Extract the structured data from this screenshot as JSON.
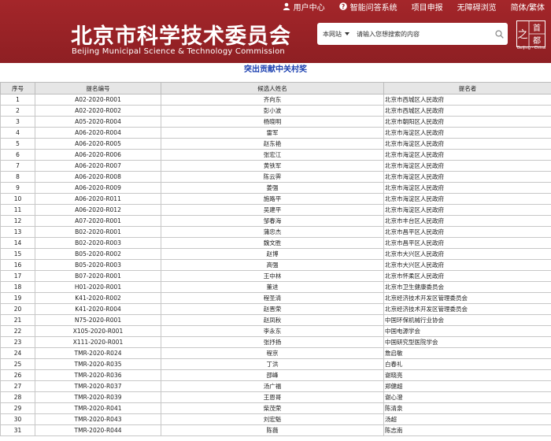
{
  "topnav": [
    {
      "icon": "user-icon",
      "label": "用户中心"
    },
    {
      "icon": "help-icon",
      "label": "智能问答系统"
    },
    {
      "icon": "",
      "label": "项目申报"
    },
    {
      "icon": "",
      "label": "无障碍浏览"
    },
    {
      "icon": "",
      "label": "简体/繁体"
    }
  ],
  "site": {
    "title": "北京市科学技术委员会",
    "subtitle": "Beijing Municipal Science & Technology Commission",
    "emblem_text": "之首都",
    "emblem_sub": "Beijing · China"
  },
  "search": {
    "scope": "本网站",
    "placeholder": "请输入您想搜索的内容"
  },
  "page_title": "突出贡献中关村奖",
  "table": {
    "headers": [
      "序号",
      "提名编号",
      "候选人姓名",
      "提名者"
    ],
    "rows": [
      [
        "1",
        "A02-2020-R001",
        "齐向东",
        "北京市西城区人民政府"
      ],
      [
        "2",
        "A02-2020-R002",
        "彭小波",
        "北京市西城区人民政府"
      ],
      [
        "3",
        "A05-2020-R004",
        "杨晓明",
        "北京市朝阳区人民政府"
      ],
      [
        "4",
        "A06-2020-R004",
        "雷军",
        "北京市海淀区人民政府"
      ],
      [
        "5",
        "A06-2020-R005",
        "赵东艳",
        "北京市海淀区人民政府"
      ],
      [
        "6",
        "A06-2020-R006",
        "张宏江",
        "北京市海淀区人民政府"
      ],
      [
        "7",
        "A06-2020-R007",
        "黄铁军",
        "北京市海淀区人民政府"
      ],
      [
        "8",
        "A06-2020-R008",
        "陈云霁",
        "北京市海淀区人民政府"
      ],
      [
        "9",
        "A06-2020-R009",
        "姜强",
        "北京市海淀区人民政府"
      ],
      [
        "10",
        "A06-2020-R011",
        "施路平",
        "北京市海淀区人民政府"
      ],
      [
        "11",
        "A06-2020-R012",
        "吴建平",
        "北京市海淀区人民政府"
      ],
      [
        "12",
        "A07-2020-R001",
        "邹春海",
        "北京市丰台区人民政府"
      ],
      [
        "13",
        "B02-2020-R001",
        "蒲忠杰",
        "北京市昌平区人民政府"
      ],
      [
        "14",
        "B02-2020-R003",
        "魏文胜",
        "北京市昌平区人民政府"
      ],
      [
        "15",
        "B05-2020-R002",
        "赵博",
        "北京市大兴区人民政府"
      ],
      [
        "16",
        "B05-2020-R003",
        "高强",
        "北京市大兴区人民政府"
      ],
      [
        "17",
        "B07-2020-R001",
        "王中林",
        "北京市怀柔区人民政府"
      ],
      [
        "18",
        "H01-2020-R001",
        "董进",
        "北京市卫生健康委员会"
      ],
      [
        "19",
        "K41-2020-R002",
        "程圣清",
        "北京经济技术开发区管理委员会"
      ],
      [
        "20",
        "K41-2020-R004",
        "赵晋荣",
        "北京经济技术开发区管理委员会"
      ],
      [
        "21",
        "N75-2020-R001",
        "赵凤秋",
        "中国环保机械行业协会"
      ],
      [
        "22",
        "X105-2020-R001",
        "李永东",
        "中国电源学会"
      ],
      [
        "23",
        "X111-2020-R001",
        "张抒扬",
        "中国研究型医院学会"
      ],
      [
        "24",
        "TMR-2020-R024",
        "程京",
        "詹启敏"
      ],
      [
        "25",
        "TMR-2020-R035",
        "丁洪",
        "白春礼"
      ],
      [
        "26",
        "TMR-2020-R036",
        "邵峰",
        "谢晓亮"
      ],
      [
        "27",
        "TMR-2020-R037",
        "汤广福",
        "郑健超"
      ],
      [
        "28",
        "TMR-2020-R039",
        "王恩哥",
        "谢心澄"
      ],
      [
        "29",
        "TMR-2020-R041",
        "柴茂荣",
        "陈清泉"
      ],
      [
        "30",
        "TMR-2020-R043",
        "刘宏魁",
        "汤超"
      ],
      [
        "31",
        "TMR-2020-R044",
        "陈薇",
        "陈志南"
      ]
    ]
  }
}
